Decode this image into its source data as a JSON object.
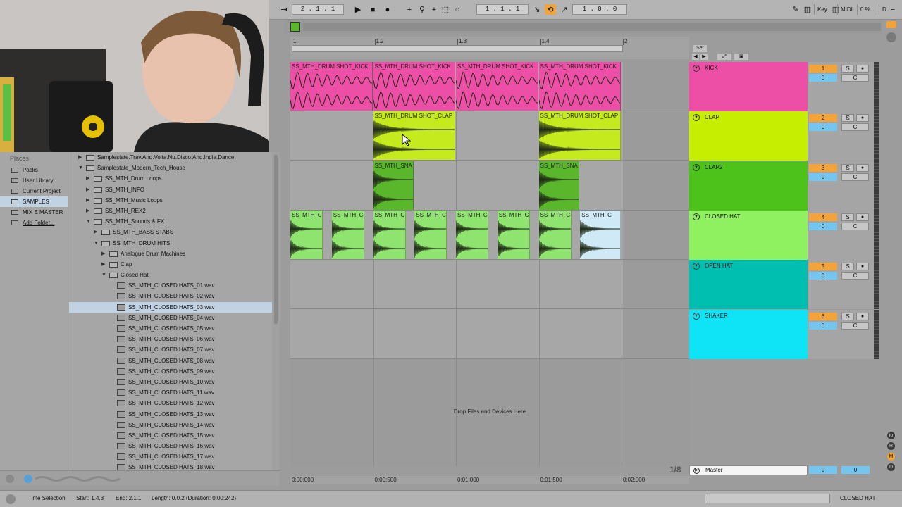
{
  "transport": {
    "arrangement_position": "2 . 1 . 1",
    "loop_start": "1 . 1 . 1",
    "loop_length": "1 . 0 . 0",
    "key_label": "Key",
    "midi_label": "MIDI",
    "cpu": "0 %",
    "d_label": "D"
  },
  "browser": {
    "places_header": "Places",
    "places": [
      {
        "label": "Packs"
      },
      {
        "label": "User Library"
      },
      {
        "label": "Current Project"
      },
      {
        "label": "SAMPLES",
        "selected": true
      },
      {
        "label": "MIX E MASTER"
      },
      {
        "label": "Add Folder..."
      }
    ],
    "tree": [
      {
        "label": "Samplestate.Trav.And.Volta.Nu.Disco.And.Indie.Dance",
        "indent": 0,
        "type": "folder",
        "open": false
      },
      {
        "label": "Samplestate_Modern_Tech_House",
        "indent": 0,
        "type": "folder",
        "open": true
      },
      {
        "label": "SS_MTH_Drum Loops",
        "indent": 1,
        "type": "folder",
        "open": false
      },
      {
        "label": "SS_MTH_INFO",
        "indent": 1,
        "type": "folder",
        "open": false
      },
      {
        "label": "SS_MTH_Music Loops",
        "indent": 1,
        "type": "folder",
        "open": false
      },
      {
        "label": "SS_MTH_REX2",
        "indent": 1,
        "type": "folder",
        "open": false
      },
      {
        "label": "SS_MTH_Sounds & FX",
        "indent": 1,
        "type": "folder",
        "open": true
      },
      {
        "label": "SS_MTH_BASS STABS",
        "indent": 2,
        "type": "folder",
        "open": false
      },
      {
        "label": "SS_MTH_DRUM HITS",
        "indent": 2,
        "type": "folder",
        "open": true
      },
      {
        "label": "Analogue Drum Machines",
        "indent": 3,
        "type": "folder",
        "open": false
      },
      {
        "label": "Clap",
        "indent": 3,
        "type": "folder",
        "open": false
      },
      {
        "label": "Closed Hat",
        "indent": 3,
        "type": "folder",
        "open": true
      },
      {
        "label": "SS_MTH_CLOSED HATS_01.wav",
        "indent": 4,
        "type": "file"
      },
      {
        "label": "SS_MTH_CLOSED HATS_02.wav",
        "indent": 4,
        "type": "file"
      },
      {
        "label": "SS_MTH_CLOSED HATS_03.wav",
        "indent": 4,
        "type": "file",
        "selected": true
      },
      {
        "label": "SS_MTH_CLOSED HATS_04.wav",
        "indent": 4,
        "type": "file"
      },
      {
        "label": "SS_MTH_CLOSED HATS_05.wav",
        "indent": 4,
        "type": "file"
      },
      {
        "label": "SS_MTH_CLOSED HATS_06.wav",
        "indent": 4,
        "type": "file"
      },
      {
        "label": "SS_MTH_CLOSED HATS_07.wav",
        "indent": 4,
        "type": "file"
      },
      {
        "label": "SS_MTH_CLOSED HATS_08.wav",
        "indent": 4,
        "type": "file"
      },
      {
        "label": "SS_MTH_CLOSED HATS_09.wav",
        "indent": 4,
        "type": "file"
      },
      {
        "label": "SS_MTH_CLOSED HATS_10.wav",
        "indent": 4,
        "type": "file"
      },
      {
        "label": "SS_MTH_CLOSED HATS_11.wav",
        "indent": 4,
        "type": "file"
      },
      {
        "label": "SS_MTH_CLOSED HATS_12.wav",
        "indent": 4,
        "type": "file"
      },
      {
        "label": "SS_MTH_CLOSED HATS_13.wav",
        "indent": 4,
        "type": "file"
      },
      {
        "label": "SS_MTH_CLOSED HATS_14.wav",
        "indent": 4,
        "type": "file"
      },
      {
        "label": "SS_MTH_CLOSED HATS_15.wav",
        "indent": 4,
        "type": "file"
      },
      {
        "label": "SS_MTH_CLOSED HATS_16.wav",
        "indent": 4,
        "type": "file"
      },
      {
        "label": "SS_MTH_CLOSED HATS_17.wav",
        "indent": 4,
        "type": "file"
      },
      {
        "label": "SS_MTH_CLOSED HATS_18.wav",
        "indent": 4,
        "type": "file"
      }
    ]
  },
  "arrangement": {
    "set_label": "Set",
    "ruler_ticks": [
      "1",
      "1.2",
      "1.3",
      "1.4",
      "2"
    ],
    "time_ticks": [
      "0:00:000",
      "0:00:500",
      "0:01:000",
      "0:01:500",
      "0:02:000"
    ],
    "drop_text": "Drop Files and Devices Here",
    "page_indicator": "1/8",
    "clips": [
      {
        "lane": 0,
        "beat": 0,
        "len": 1,
        "title": "SS_MTH_DRUM SHOT_KICK",
        "color": "#ee4fa6",
        "wave": "kick"
      },
      {
        "lane": 0,
        "beat": 1,
        "len": 1,
        "title": "SS_MTH_DRUM SHOT_KICK",
        "color": "#ee4fa6",
        "wave": "kick"
      },
      {
        "lane": 0,
        "beat": 2,
        "len": 1,
        "title": "SS_MTH_DRUM SHOT_KICK",
        "color": "#ee4fa6",
        "wave": "kick"
      },
      {
        "lane": 0,
        "beat": 3,
        "len": 1,
        "title": "SS_MTH_DRUM SHOT_KICK",
        "color": "#ee4fa6",
        "wave": "kick"
      },
      {
        "lane": 1,
        "beat": 1,
        "len": 1,
        "title": "SS_MTH_DRUM SHOT_CLAP",
        "color": "#c5ea1e",
        "wave": "decay"
      },
      {
        "lane": 1,
        "beat": 3,
        "len": 1,
        "title": "SS_MTH_DRUM SHOT_CLAP",
        "color": "#c5ea1e",
        "wave": "decay"
      },
      {
        "lane": 2,
        "beat": 1,
        "len": 0.5,
        "title": "SS_MTH_SNA",
        "color": "#5ab72c",
        "wave": "decay"
      },
      {
        "lane": 2,
        "beat": 3,
        "len": 0.5,
        "title": "SS_MTH_SNA",
        "color": "#5ab72c",
        "wave": "decay"
      },
      {
        "lane": 3,
        "beat": 0,
        "len": 0.4,
        "title": "SS_MTH_C",
        "color": "#8fe470",
        "wave": "decay"
      },
      {
        "lane": 3,
        "beat": 0.5,
        "len": 0.4,
        "title": "SS_MTH_C",
        "color": "#8fe470",
        "wave": "decay"
      },
      {
        "lane": 3,
        "beat": 1,
        "len": 0.4,
        "title": "SS_MTH_C",
        "color": "#8fe470",
        "wave": "decay"
      },
      {
        "lane": 3,
        "beat": 1.5,
        "len": 0.4,
        "title": "SS_MTH_C",
        "color": "#8fe470",
        "wave": "decay"
      },
      {
        "lane": 3,
        "beat": 2,
        "len": 0.4,
        "title": "SS_MTH_C",
        "color": "#8fe470",
        "wave": "decay"
      },
      {
        "lane": 3,
        "beat": 2.5,
        "len": 0.4,
        "title": "SS_MTH_C",
        "color": "#8fe470",
        "wave": "decay"
      },
      {
        "lane": 3,
        "beat": 3,
        "len": 0.4,
        "title": "SS_MTH_C",
        "color": "#8fe470",
        "wave": "decay"
      },
      {
        "lane": 3,
        "beat": 3.5,
        "len": 0.5,
        "title": "SS_MTH_C",
        "color": "#cfe9f7",
        "wave": "decay"
      }
    ]
  },
  "tracks": [
    {
      "name": "KICK",
      "number": "1",
      "color": "#ee4fa6",
      "volume": "0"
    },
    {
      "name": "CLAP",
      "number": "2",
      "color": "#c5ee00",
      "volume": "0"
    },
    {
      "name": "CLAP2",
      "number": "3",
      "color": "#4cc21a",
      "volume": "0"
    },
    {
      "name": "CLOSED HAT",
      "number": "4",
      "color": "#8ff060",
      "volume": "0"
    },
    {
      "name": "OPEN HAT",
      "number": "5",
      "color": "#00bfb0",
      "volume": "0"
    },
    {
      "name": "SHAKER",
      "number": "6",
      "color": "#0ee4f6",
      "volume": "0"
    }
  ],
  "track_buttons": {
    "solo": "S",
    "cue": "C"
  },
  "master": {
    "name": "Master",
    "volume_a": "0",
    "volume_b": "0"
  },
  "status": {
    "label": "Time Selection",
    "start": "Start: 1.4.3",
    "end": "End: 2.1.1",
    "length": "Length: 0.0.2 (Duration: 0:00:242)",
    "selected_track": "CLOSED HAT"
  }
}
